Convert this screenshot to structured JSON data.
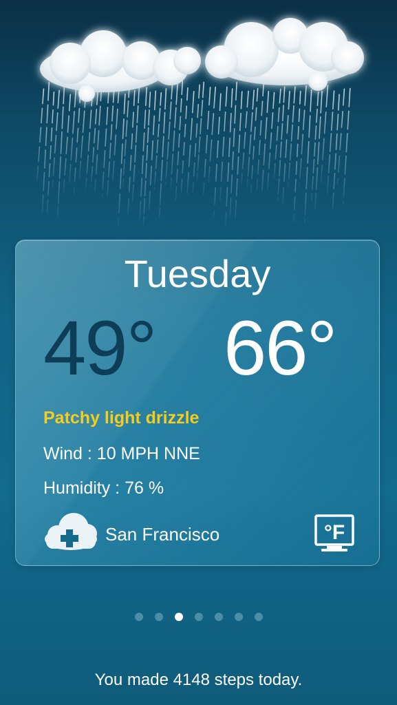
{
  "forecast": {
    "day": "Tuesday",
    "low": "49°",
    "high": "66°",
    "condition": "Patchy light drizzle",
    "wind": "Wind : 10 MPH NNE",
    "humidity": "Humidity : 76 %",
    "city": "San Francisco",
    "unit_label": "°F"
  },
  "pager": {
    "total": 7,
    "active_index": 2
  },
  "footer": {
    "steps_text": "You made 4148 steps today."
  },
  "icons": {
    "weather": "rain-cloud-icon",
    "add_city": "cloud-plus-icon",
    "unit": "fahrenheit-monitor-icon"
  },
  "colors": {
    "low_temp": "#0d3d57",
    "condition": "#f5cd1e",
    "accent_white": "#ffffff"
  }
}
